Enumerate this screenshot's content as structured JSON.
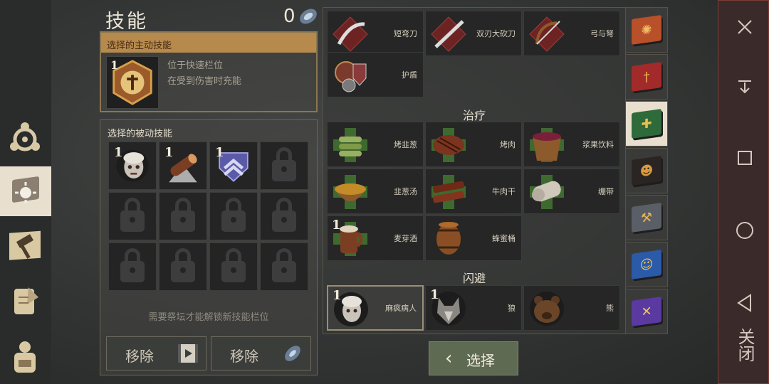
{
  "header": {
    "title": "技能",
    "points": "0"
  },
  "active_panel": {
    "header": "选择的主动技能",
    "count": "1",
    "desc_line1": "位于快速栏位",
    "desc_line2": "在受到伤害时充能"
  },
  "passive_panel": {
    "title": "选择的被动技能",
    "slots": [
      {
        "count": "1",
        "icon": "zombie-face-icon"
      },
      {
        "count": "1",
        "icon": "log-icon"
      },
      {
        "count": "1",
        "icon": "shield-claw-icon"
      }
    ],
    "hint": "需要祭坛才能解锁新技能栏位",
    "remove1": "移除",
    "remove2": "移除"
  },
  "skills": {
    "weapons": [
      {
        "label": "短弯刀"
      },
      {
        "label": "双刃大砍刀"
      },
      {
        "label": "弓与弩"
      },
      {
        "label": "护盾"
      }
    ],
    "heal_title": "治疗",
    "heal": [
      {
        "label": "烤韭葱"
      },
      {
        "label": "烤肉"
      },
      {
        "label": "浆果饮料"
      },
      {
        "label": "韭葱汤"
      },
      {
        "label": "牛肉干"
      },
      {
        "label": "绷带"
      },
      {
        "label": "麦芽酒",
        "count": "1"
      },
      {
        "label": "蜂蜜桶"
      }
    ],
    "dodge_title": "闪避",
    "dodge": [
      {
        "label": "麻疯病人",
        "count": "1"
      },
      {
        "label": "狼",
        "count": "1"
      },
      {
        "label": "熊"
      }
    ]
  },
  "select_button": "选择",
  "system": {
    "close": "关闭"
  },
  "colors": {
    "accent": "#b68a4d",
    "select": "#5f6a53",
    "active_tab": "#e8dfcf"
  }
}
